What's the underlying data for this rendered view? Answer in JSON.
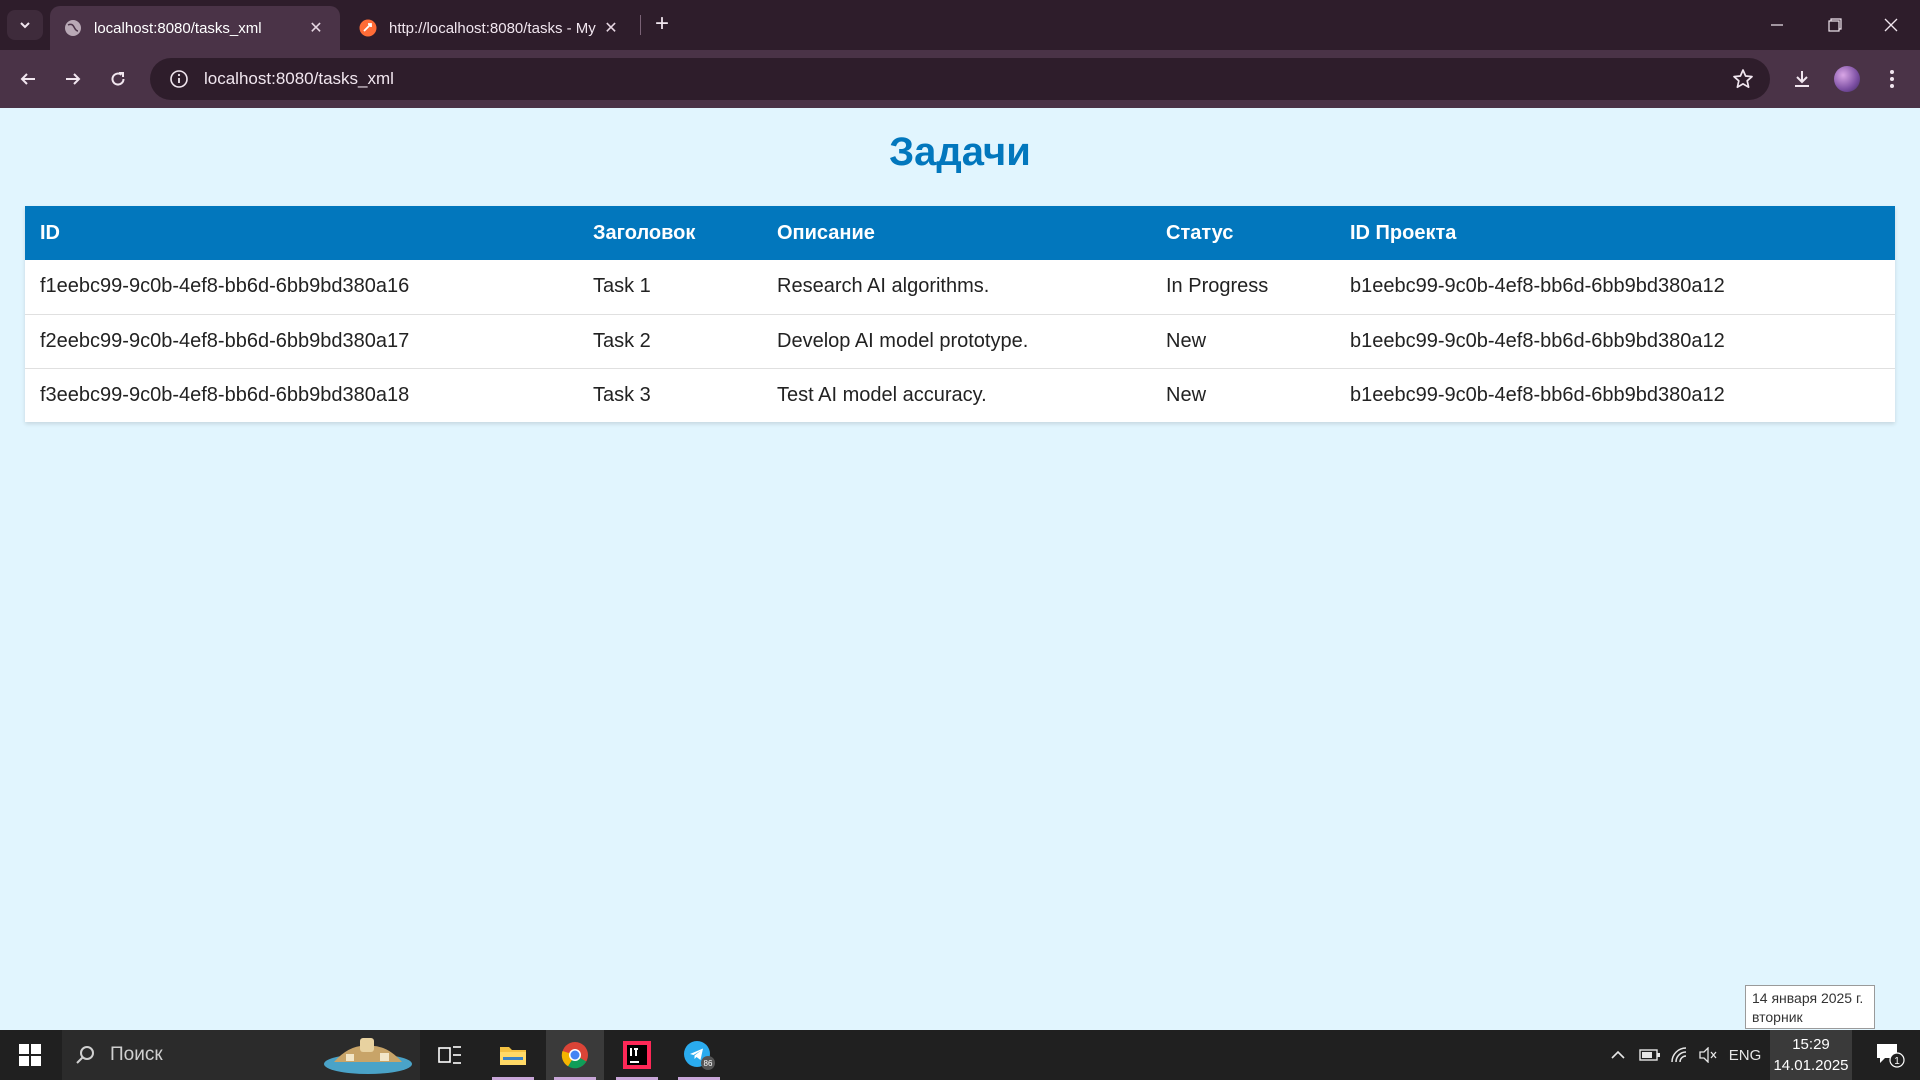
{
  "browser": {
    "tabs": [
      {
        "title": "localhost:8080/tasks_xml",
        "favicon": "globe-icon",
        "active": true
      },
      {
        "title": "http://localhost:8080/tasks - My",
        "favicon": "postman-icon",
        "active": false
      }
    ],
    "url": "localhost:8080/tasks_xml"
  },
  "page": {
    "title": "Задачи",
    "table": {
      "headers": [
        "ID",
        "Заголовок",
        "Описание",
        "Статус",
        "ID Проекта"
      ],
      "rows": [
        [
          "f1eebc99-9c0b-4ef8-bb6d-6bb9bd380a16",
          "Task 1",
          "Research AI algorithms.",
          "In Progress",
          "b1eebc99-9c0b-4ef8-bb6d-6bb9bd380a12"
        ],
        [
          "f2eebc99-9c0b-4ef8-bb6d-6bb9bd380a17",
          "Task 2",
          "Develop AI model prototype.",
          "New",
          "b1eebc99-9c0b-4ef8-bb6d-6bb9bd380a12"
        ],
        [
          "f3eebc99-9c0b-4ef8-bb6d-6bb9bd380a18",
          "Task 3",
          "Test AI model accuracy.",
          "New",
          "b1eebc99-9c0b-4ef8-bb6d-6bb9bd380a12"
        ]
      ]
    }
  },
  "tooltip": {
    "line1": "14 января 2025 г.",
    "line2": "вторник"
  },
  "taskbar": {
    "search_placeholder": "Поиск",
    "language": "ENG",
    "time": "15:29",
    "date": "14.01.2025",
    "notification_count": "1",
    "telegram_badge": "86"
  },
  "colors": {
    "accent": "#0277bd",
    "page_bg": "#e1f5fe",
    "chrome_dark": "#2e1d2b",
    "chrome_light": "#4a3347"
  }
}
